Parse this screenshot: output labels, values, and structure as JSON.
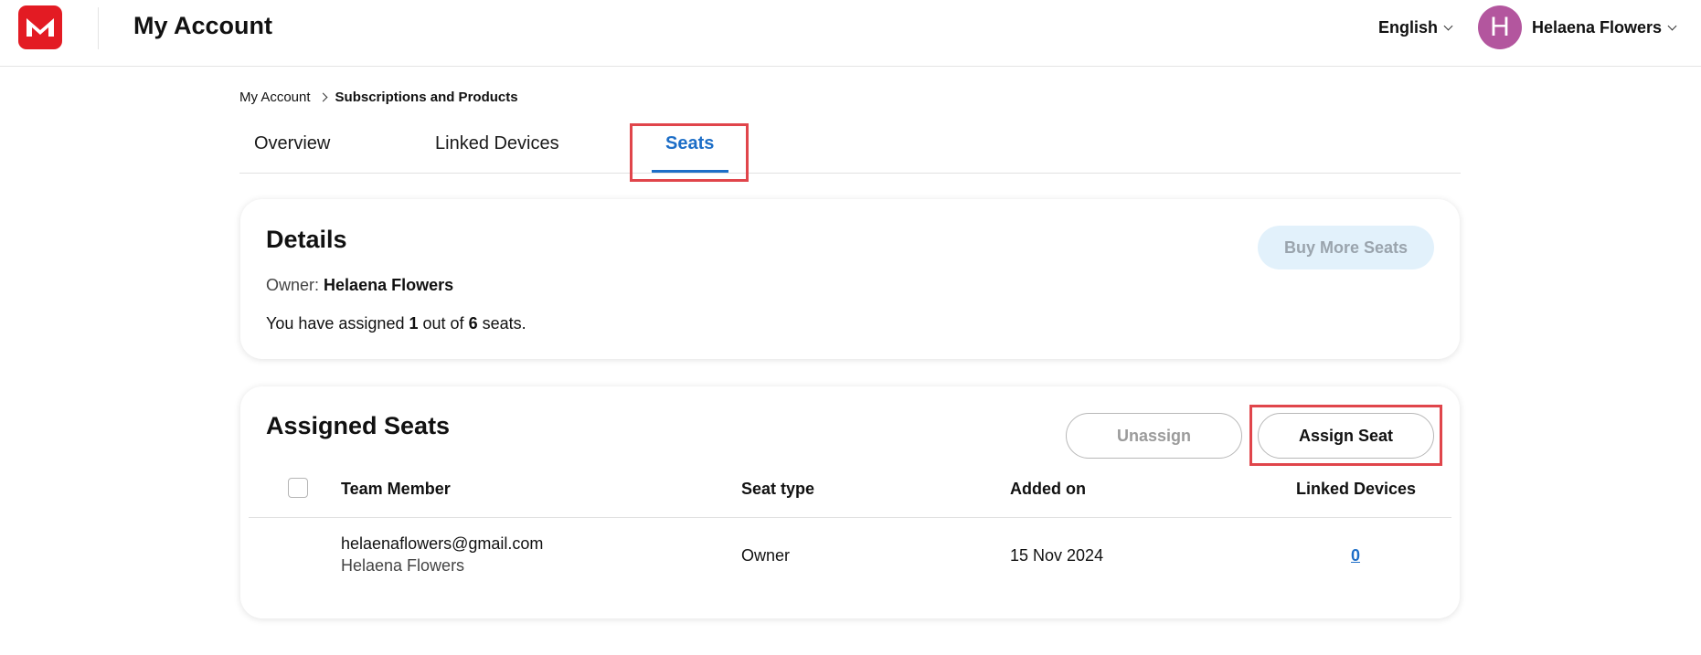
{
  "header": {
    "title": "My Account",
    "logo_icon": "m-logo-icon",
    "language": "English",
    "user": {
      "initial": "H",
      "name": "Helaena Flowers"
    }
  },
  "breadcrumb": {
    "root": "My Account",
    "current": "Subscriptions and Products"
  },
  "tabs": [
    {
      "label": "Overview",
      "active": false
    },
    {
      "label": "Linked Devices",
      "active": false
    },
    {
      "label": "Seats",
      "active": true
    }
  ],
  "details": {
    "title": "Details",
    "buy_more_label": "Buy More Seats",
    "owner_label": "Owner:",
    "owner_name": "Helaena Flowers",
    "assigned_prefix": "You have assigned",
    "assigned_count": "1",
    "assigned_mid": "out of",
    "total_seats": "6",
    "assigned_suffix": "seats."
  },
  "assigned": {
    "title": "Assigned Seats",
    "unassign_label": "Unassign",
    "assign_label": "Assign Seat",
    "columns": [
      "Team Member",
      "Seat type",
      "Added on",
      "Linked Devices"
    ],
    "rows": [
      {
        "email": "helaenaflowers@gmail.com",
        "name": "Helaena Flowers",
        "seat_type": "Owner",
        "added_on": "15 Nov 2024",
        "linked_devices": "0"
      }
    ]
  },
  "colors": {
    "accent": "#1d6ec7",
    "brand": "#e31b23",
    "highlight": "#e0454b",
    "avatar": "#b3569e"
  }
}
